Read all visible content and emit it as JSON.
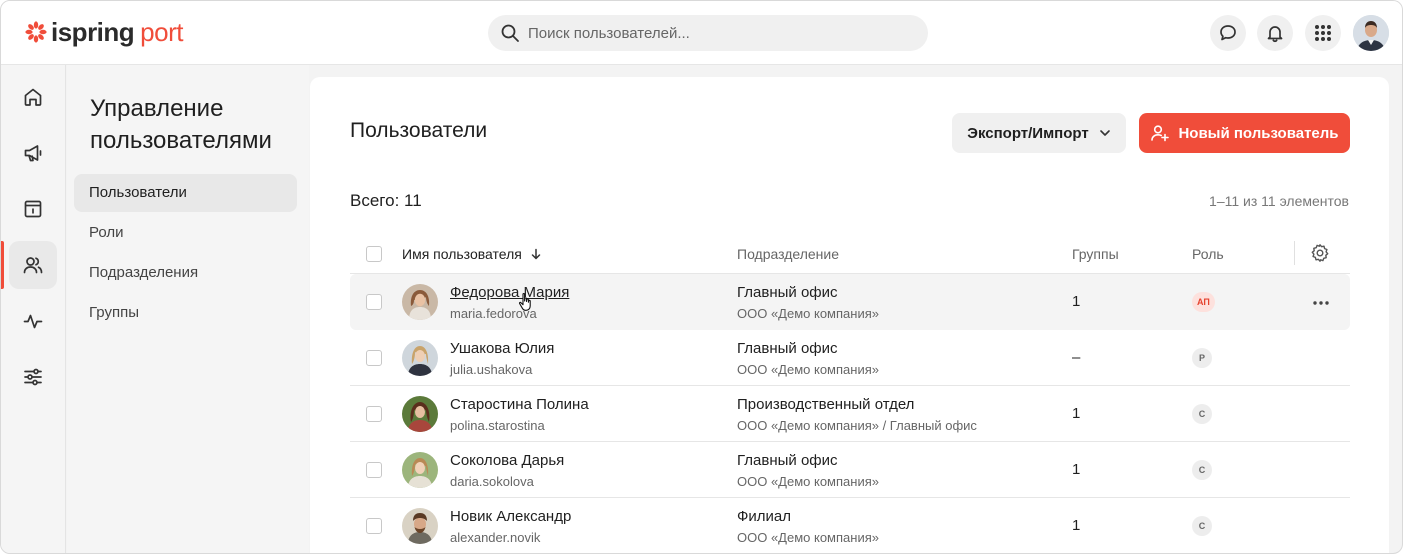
{
  "brand": {
    "logo_main": "ispring",
    "logo_accent": "port",
    "accent_color": "#f04d3a"
  },
  "search": {
    "placeholder": "Поиск пользователей..."
  },
  "topbar_icons": [
    "chat-icon",
    "bell-icon",
    "apps-grid-icon",
    "user-avatar"
  ],
  "rail_icons": [
    "home-icon",
    "megaphone-icon",
    "catalog-icon",
    "users-icon",
    "activity-icon",
    "settings-sliders-icon"
  ],
  "rail_active": "users-icon",
  "sidebar": {
    "title": "Управление пользователями",
    "items": [
      {
        "label": "Пользователи",
        "active": true
      },
      {
        "label": "Роли",
        "active": false
      },
      {
        "label": "Подразделения",
        "active": false
      },
      {
        "label": "Группы",
        "active": false
      }
    ]
  },
  "main": {
    "title": "Пользователи",
    "export_label": "Экспорт/Импорт",
    "new_user_label": "Новый пользователь",
    "total_label": "Всего: 11",
    "pager_label": "1–11 из 11 элементов"
  },
  "table": {
    "headers": {
      "name": "Имя пользователя",
      "department": "Подразделение",
      "groups": "Группы",
      "role": "Роль"
    },
    "rows": [
      {
        "name": "Федорова Мария",
        "login": "maria.fedorova",
        "department": "Главный офис",
        "company": "ООО «Демо компания»",
        "groups": "1",
        "role": "АП",
        "hover": true
      },
      {
        "name": "Ушакова Юлия",
        "login": "julia.ushakova",
        "department": "Главный офис",
        "company": "ООО «Демо компания»",
        "groups": "–",
        "role": "Р"
      },
      {
        "name": "Старостина Полина",
        "login": "polina.starostina",
        "department": "Производственный отдел",
        "company": "ООО «Демо компания» / Главный офис",
        "groups": "1",
        "role": "С"
      },
      {
        "name": "Соколова Дарья",
        "login": "daria.sokolova",
        "department": "Главный офис",
        "company": "ООО «Демо компания»",
        "groups": "1",
        "role": "С"
      },
      {
        "name": "Новик Александр",
        "login": "alexander.novik",
        "department": "Филиал",
        "company": "ООО «Демо компания»",
        "groups": "1",
        "role": "С"
      }
    ]
  }
}
